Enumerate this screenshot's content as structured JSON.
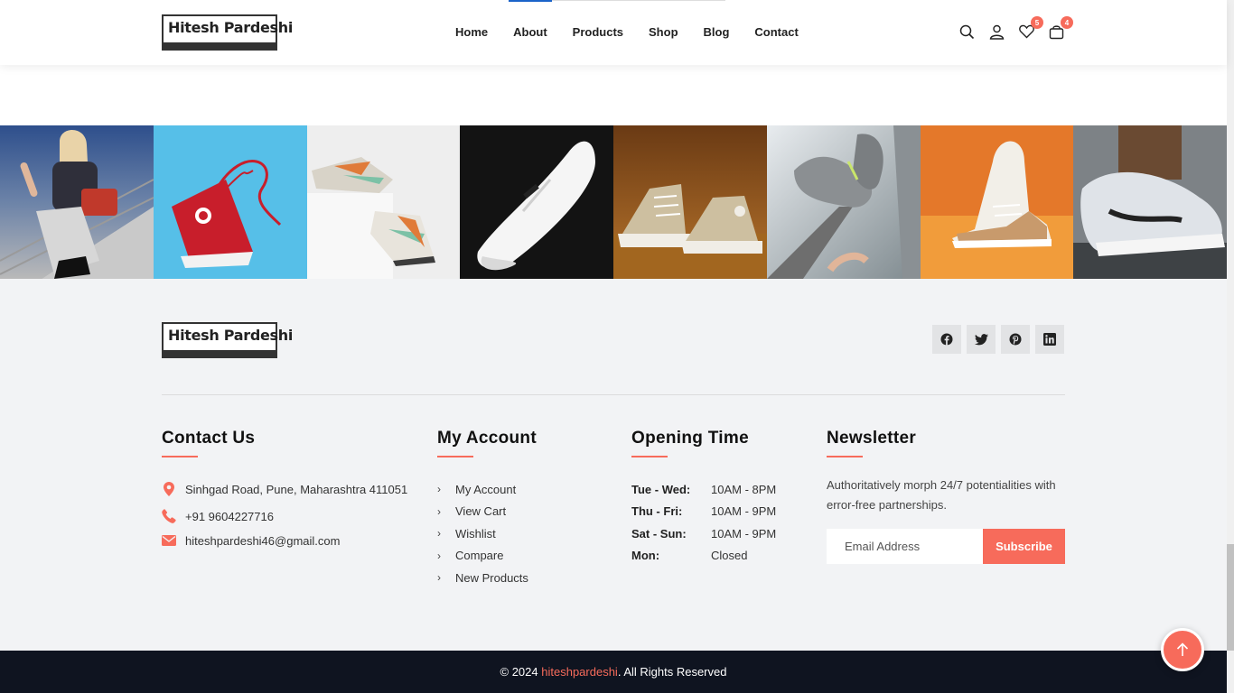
{
  "brand": {
    "logo_text": "Hitesh Pardeshi"
  },
  "nav": {
    "items": [
      "Home",
      "About",
      "Products",
      "Shop",
      "Blog",
      "Contact"
    ]
  },
  "header_icons": {
    "search": "search-icon",
    "account": "user-icon",
    "wishlist_count": "5",
    "cart_count": "4"
  },
  "gallery": {
    "images": [
      "sneaker-girl-on-stairs",
      "red-hightop-sneaker",
      "colorful-sneakers-on-box",
      "white-sneaker-black-bg",
      "beige-canvas-sneakers",
      "grey-knit-sneaker-thrown",
      "white-sneaker-orange-bg",
      "grey-running-shoe"
    ]
  },
  "social": [
    "facebook-icon",
    "twitter-icon",
    "pinterest-icon",
    "linkedin-icon"
  ],
  "contact": {
    "title": "Contact Us",
    "address": "Sinhgad Road, Pune, Maharashtra 411051",
    "phone": "+91 9604227716",
    "email": "hiteshpardeshi46@gmail.com"
  },
  "account": {
    "title": "My Account",
    "links": [
      "My Account",
      "View Cart",
      "Wishlist",
      "Compare",
      "New Products"
    ]
  },
  "opening": {
    "title": "Opening Time",
    "rows": [
      {
        "day": "Tue - Wed:",
        "hours": "10AM - 8PM"
      },
      {
        "day": "Thu - Fri:",
        "hours": "10AM - 9PM"
      },
      {
        "day": "Sat - Sun:",
        "hours": "10AM - 9PM"
      },
      {
        "day": "Mon:",
        "hours": "Closed"
      }
    ]
  },
  "newsletter": {
    "title": "Newsletter",
    "text": "Authoritatively morph 24/7 potentialities with error-free partnerships.",
    "placeholder": "Email Address",
    "button": "Subscribe"
  },
  "copyright": {
    "prefix": "© 2024 ",
    "brand": "hiteshpardeshi",
    "suffix": ". All Rights Reserved"
  },
  "colors": {
    "accent": "#f76b5b",
    "footer_bg": "#f2f3f5",
    "bottom_bar": "#0f1420"
  }
}
